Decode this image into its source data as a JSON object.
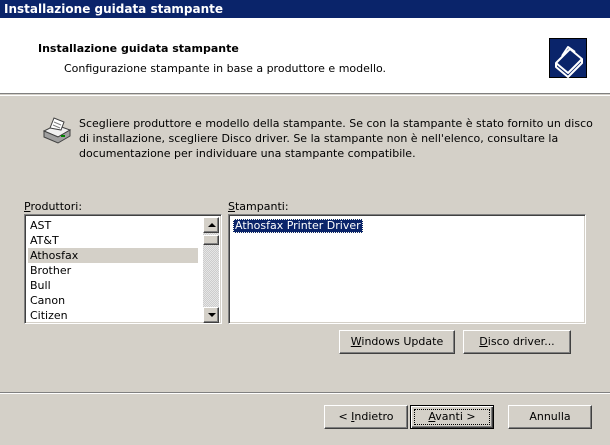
{
  "window": {
    "title": "Installazione guidata stampante"
  },
  "header": {
    "title": "Installazione guidata stampante",
    "subtitle": "Configurazione stampante in base a produttore e modello.",
    "icon": "printer-wizard-icon"
  },
  "intro": {
    "icon": "printer-icon",
    "text": "Scegliere produttore e modello della stampante. Se con la stampante è stato fornito un disco di installazione, scegliere Disco driver. Se la stampante non è nell'elenco, consultare la documentazione per individuare una stampante compatibile."
  },
  "manufacturers": {
    "label_mnemonic": "P",
    "label_rest": "roduttori:",
    "items": [
      "AST",
      "AT&T",
      "Athosfax",
      "Brother",
      "Bull",
      "Canon",
      "Citizen"
    ],
    "selected": "Athosfax"
  },
  "printers": {
    "label_mnemonic": "S",
    "label_rest": "tampanti:",
    "items": [
      "Athosfax Printer Driver"
    ],
    "selected": "Athosfax Printer Driver"
  },
  "buttons": {
    "windows_update": {
      "mnemonic": "W",
      "rest": "indows Update"
    },
    "disco_driver": {
      "mnemonic": "D",
      "rest": "isco driver..."
    },
    "back": {
      "pre": "< ",
      "mnemonic": "I",
      "rest": "ndietro"
    },
    "next": {
      "mnemonic": "A",
      "rest": "vanti >"
    },
    "cancel": {
      "label": "Annulla"
    }
  },
  "colors": {
    "face": "#d4d0c8",
    "title": "#0a246a",
    "selection": "#0a246a"
  }
}
